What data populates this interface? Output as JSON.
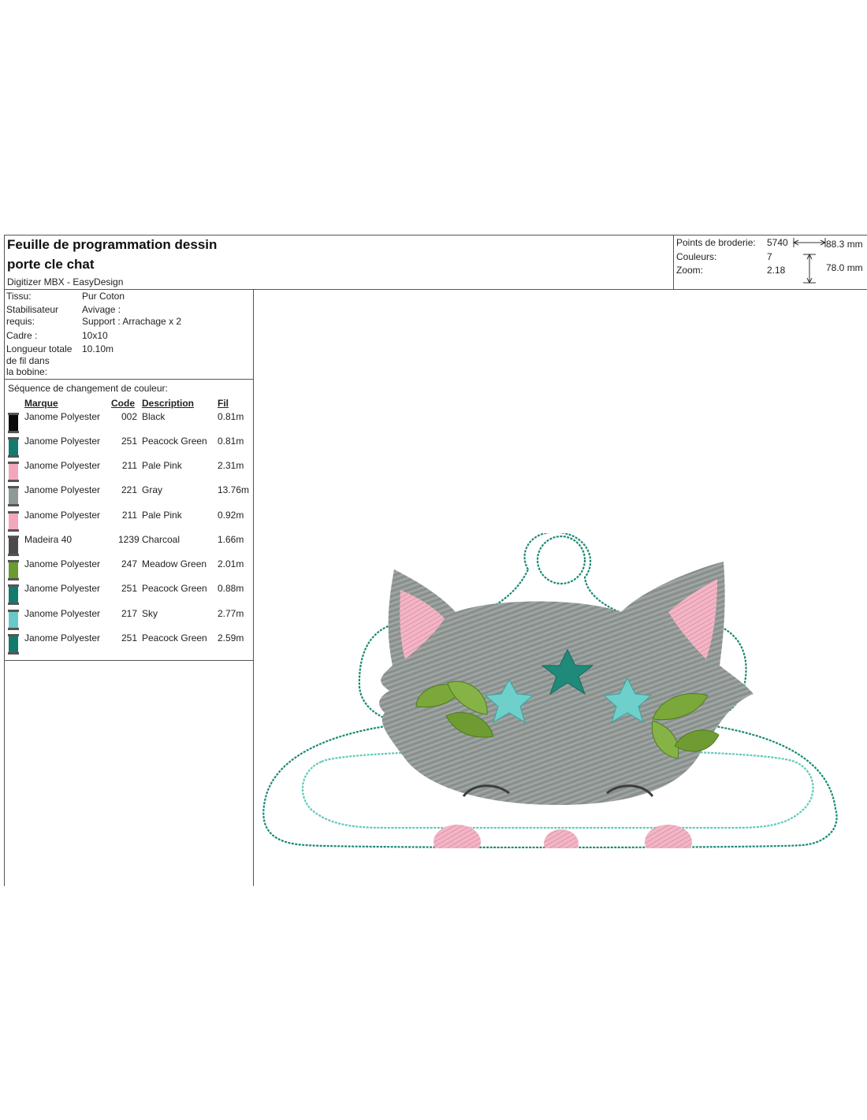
{
  "header": {
    "title_line1": "Feuille de programmation dessin",
    "title_line2": "porte cle chat",
    "software": "Digitizer MBX - EasyDesign"
  },
  "stats": {
    "points_label": "Points de broderie:",
    "points_value": "5740",
    "colors_label": "Couleurs:",
    "colors_value": "7",
    "zoom_label": "Zoom:",
    "zoom_value": "2.18",
    "width": "88.3 mm",
    "height": "78.0 mm"
  },
  "properties": {
    "fabric_label": "Tissu:",
    "fabric_value": "Pur Coton",
    "stabilizer_label_1": "Stabilisateur",
    "stabilizer_label_2": "requis:",
    "stabilizer_value_1": "Avivage :",
    "stabilizer_value_2": "Support : Arrachage x 2",
    "frame_label": "Cadre :",
    "frame_value": "10x10",
    "length_label_1": "Longueur totale",
    "length_label_2": "de fil dans",
    "length_label_3": "la bobine:",
    "length_value": "10.10m"
  },
  "sequence": {
    "title": "Séquence de changement de couleur:",
    "headers": {
      "brand": "Marque",
      "code": "Code",
      "description": "Description",
      "thread": "Fil"
    },
    "rows": [
      {
        "brand": "Janome Polyester",
        "code": "002",
        "description": "Black",
        "thread": "0.81m",
        "color": "#0a0a0a"
      },
      {
        "brand": "Janome Polyester",
        "code": "251",
        "description": "Peacock Green",
        "thread": "0.81m",
        "color": "#137a6e"
      },
      {
        "brand": "Janome Polyester",
        "code": "211",
        "description": "Pale Pink",
        "thread": "2.31m",
        "color": "#f2a7bd"
      },
      {
        "brand": "Janome Polyester",
        "code": "221",
        "description": "Gray",
        "thread": "13.76m",
        "color": "#8f9996"
      },
      {
        "brand": "Janome Polyester",
        "code": "211",
        "description": "Pale Pink",
        "thread": "0.92m",
        "color": "#f2a7bd"
      },
      {
        "brand": "Madeira 40",
        "code": "1239",
        "description": "Charcoal",
        "thread": "1.66m",
        "color": "#4a4a4a"
      },
      {
        "brand": "Janome Polyester",
        "code": "247",
        "description": "Meadow Green",
        "thread": "2.01m",
        "color": "#6b9a2e"
      },
      {
        "brand": "Janome Polyester",
        "code": "251",
        "description": "Peacock Green",
        "thread": "0.88m",
        "color": "#137a6e"
      },
      {
        "brand": "Janome Polyester",
        "code": "217",
        "description": "Sky",
        "thread": "2.77m",
        "color": "#69c9c8"
      },
      {
        "brand": "Janome Polyester",
        "code": "251",
        "description": "Peacock Green",
        "thread": "2.59m",
        "color": "#137a6e"
      }
    ]
  },
  "design_colors": {
    "outline": "#1a8a74",
    "inner_outline": "#5fcab7",
    "gray": "#8e9592",
    "pink": "#f2aebf",
    "leaf": "#7aa83a",
    "star_dark": "#1f8a7a",
    "star_light": "#6fcfcb",
    "charcoal": "#3d3d3d"
  }
}
